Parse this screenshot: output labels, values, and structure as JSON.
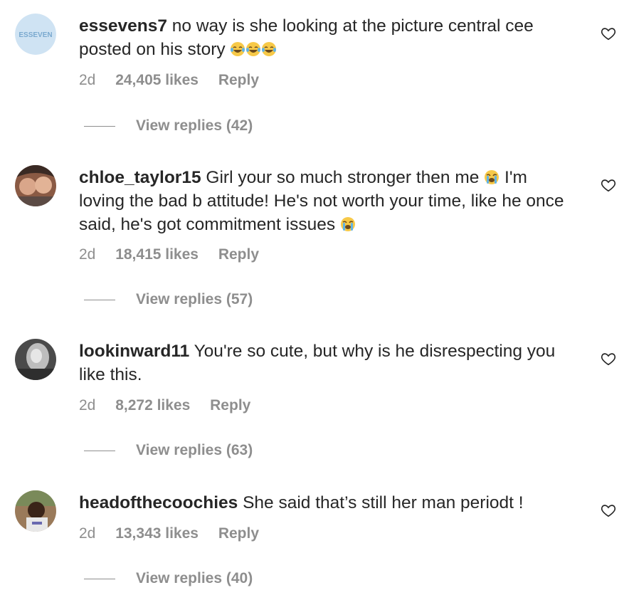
{
  "comments": [
    {
      "username": "essevens7",
      "text": "no way is she looking at the picture central cee posted on his story",
      "emoji_suffix": [
        "laughing-crying",
        "laughing-crying",
        "laughing-crying"
      ],
      "time": "2d",
      "likes": "24,405 likes",
      "reply_label": "Reply",
      "view_replies": "View replies (42)",
      "avatar_label": "ESSEVEN"
    },
    {
      "username": "chloe_taylor15",
      "text_part1": "Girl your so much stronger then me",
      "text_part2": "I'm loving the bad b attitude! He's not worth your time, like he once said, he's got commitment issues",
      "time": "2d",
      "likes": "18,415 likes",
      "reply_label": "Reply",
      "view_replies": "View replies (57)"
    },
    {
      "username": "lookinward11",
      "text": "You're so cute, but why is he disrespecting you like this.",
      "time": "2d",
      "likes": "8,272 likes",
      "reply_label": "Reply",
      "view_replies": "View replies (63)"
    },
    {
      "username": "headofthecoochies",
      "text": "She said that’s still her man periodt !",
      "time": "2d",
      "likes": "13,343 likes",
      "reply_label": "Reply",
      "view_replies": "View replies (40)"
    }
  ],
  "icons": {
    "like": "heart-outline-icon",
    "laughing": "face-with-tears-of-joy",
    "crying": "loudly-crying-face"
  },
  "colors": {
    "text": "#262626",
    "secondary": "#8e8e8e",
    "avatar_bg_1": "#cfe3f3",
    "avatar_text_1": "#7aa9cf"
  }
}
